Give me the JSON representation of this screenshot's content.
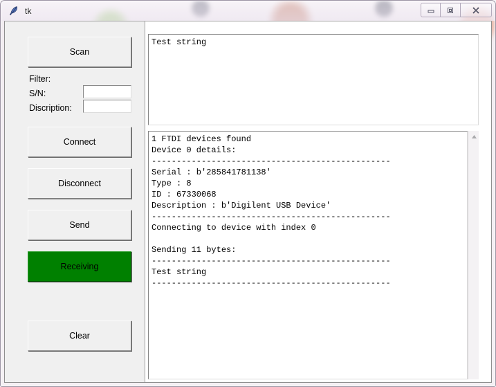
{
  "window": {
    "title": "tk",
    "icon": "feather-icon",
    "controls": [
      {
        "name": "minimize-button",
        "glyph": "minimize-icon"
      },
      {
        "name": "restore-button",
        "glyph": "restore-icon"
      },
      {
        "name": "close-button",
        "glyph": "close-icon"
      }
    ]
  },
  "sidebar": {
    "scan_label": "Scan",
    "filter_label": "Filter:",
    "sn_label": "S/N:",
    "description_label": "Discription:",
    "sn_value": "",
    "sn_placeholder": "",
    "description_value": "",
    "description_placeholder": "",
    "connect_label": "Connect",
    "disconnect_label": "Disconnect",
    "send_label": "Send",
    "receiving_label": "Receiving",
    "receiving_color": "#008000",
    "clear_label": "Clear"
  },
  "send_panel": {
    "value": "Test string"
  },
  "log_panel": {
    "value": "1 FTDI devices found\nDevice 0 details:\n------------------------------------------------\nSerial : b'285841781138'\nType : 8\nID : 67330068\nDescription : b'Digilent USB Device'\n------------------------------------------------\nConnecting to device with index 0\n\nSending 11 bytes:\n------------------------------------------------\nTest string\n------------------------------------------------",
    "scrollbar": {
      "up_arrow": "scroll-up-arrow-icon"
    }
  }
}
